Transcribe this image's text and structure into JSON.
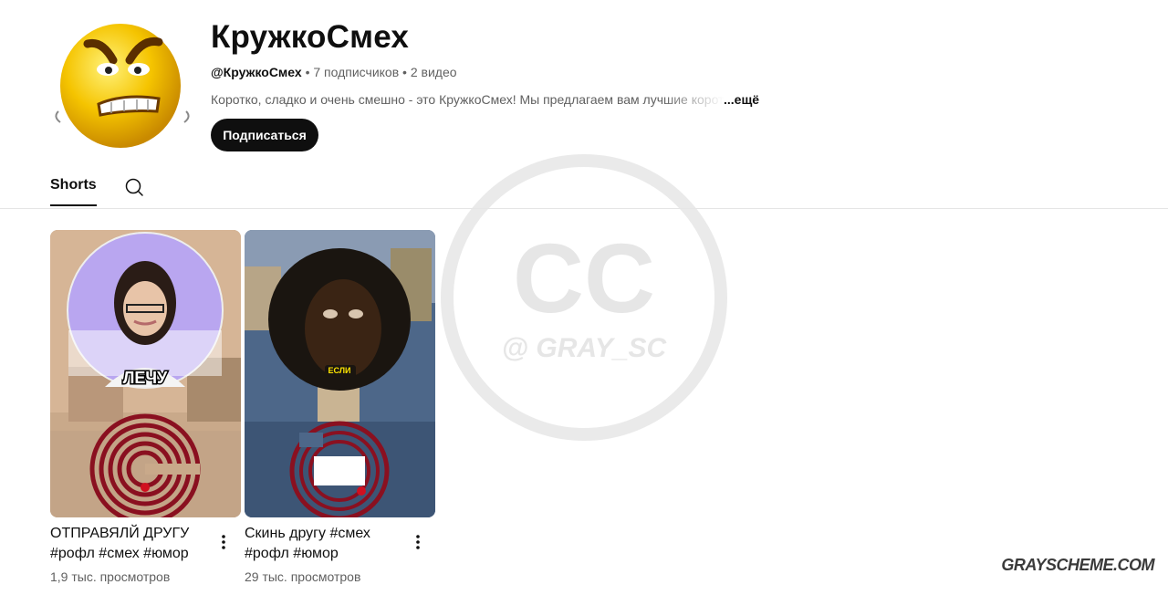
{
  "channel": {
    "name": "КружкоСмех",
    "handle": "@КружкоСмех",
    "subscribers": "7 подписчиков",
    "videos": "2 видео",
    "separator": "•",
    "description": "Коротко, сладко и очень смешно - это КружкоСмех! Мы предлагаем вам лучшие короткие видео",
    "more_label": "...ещё",
    "subscribe_label": "Подписаться",
    "avatar_icon": "angry-emoji-face"
  },
  "tabs": [
    {
      "label": "Shorts",
      "active": true
    }
  ],
  "search_icon": "search-icon",
  "shorts": [
    {
      "title": "ОТПРАВЯЛЙ ДРУГУ #рофл #смех #юмор",
      "views": "1,9 тыс. просмотров",
      "caption": "ЛЕЧУ"
    },
    {
      "title": "Скинь другу #смех #рофл #юмор",
      "views": "29 тыс. просмотров",
      "caption": "ЕСЛИ"
    }
  ],
  "watermark": {
    "top": "CC",
    "bottom": "@ GRAY_SC"
  },
  "corner_watermark": "GRAYSCHEME.COM",
  "colors": {
    "button_bg": "#0f0f0f",
    "meta_text": "#606060",
    "avatar_yellow": "#f5c400"
  }
}
